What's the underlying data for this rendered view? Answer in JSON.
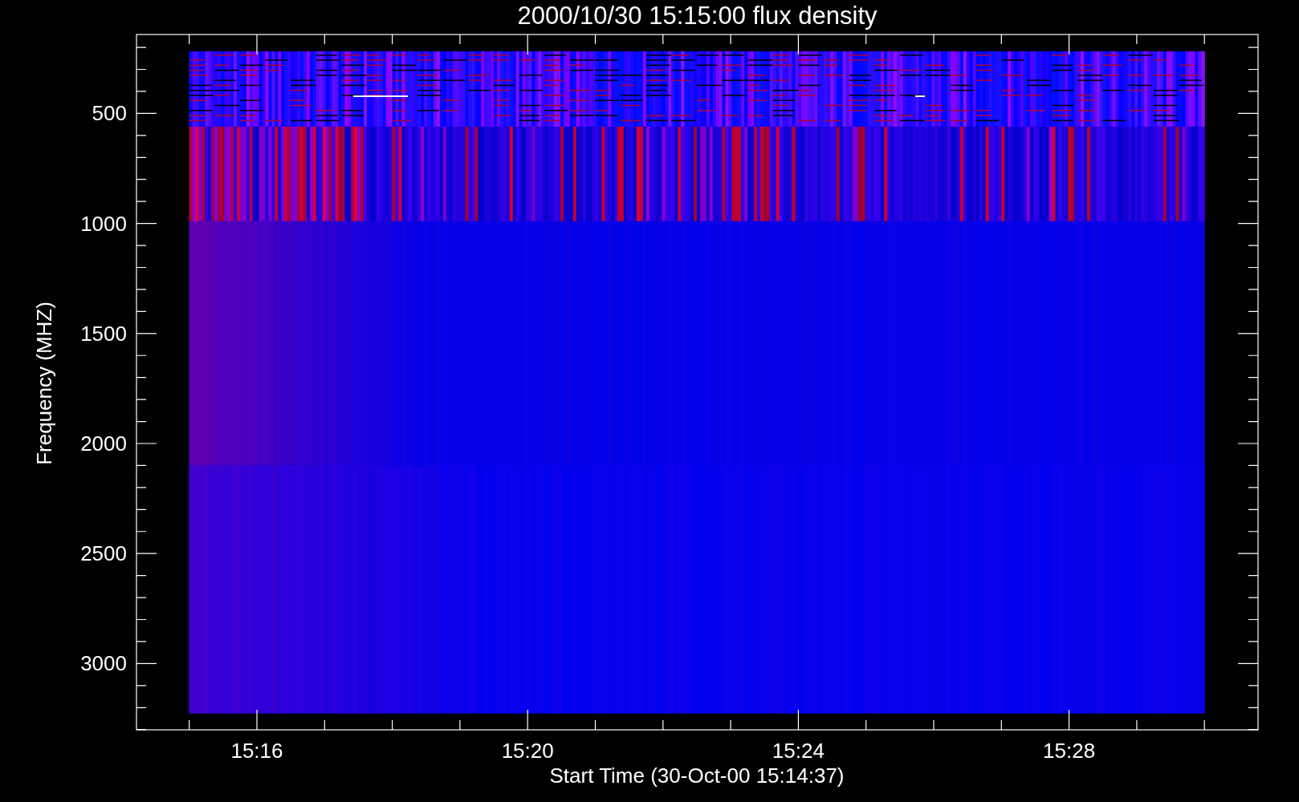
{
  "title": "2000/10/30 15:15:00 flux density",
  "y_axis": {
    "label": "Frequency (MHZ)",
    "tick_labels": [
      "500",
      "1000",
      "1500",
      "2000",
      "2500",
      "3000"
    ]
  },
  "x_axis": {
    "label": "Start Time (30-Oct-00 15:14:37)",
    "tick_labels": [
      "15:16",
      "15:20",
      "15:24",
      "15:28"
    ]
  }
}
